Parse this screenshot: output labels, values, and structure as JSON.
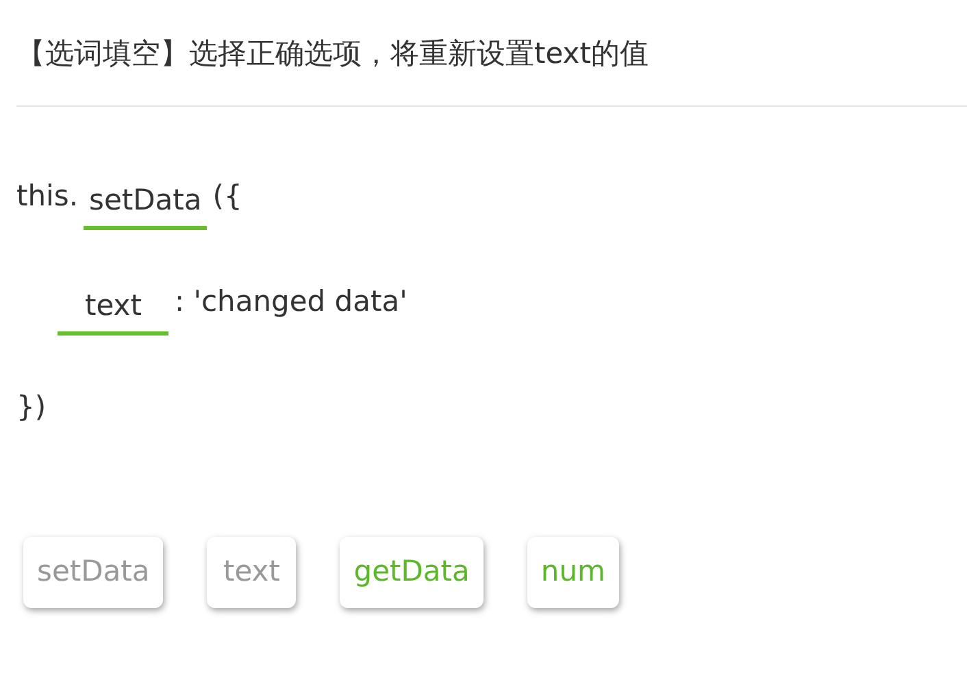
{
  "title": "【选词填空】选择正确选项，将重新设置text的值",
  "code_lines": [
    {
      "parts": [
        {
          "kind": "text",
          "text": "this."
        },
        {
          "kind": "blank",
          "text": "setData"
        },
        {
          "kind": "text",
          "text": "({"
        }
      ]
    },
    {
      "parts": [
        {
          "kind": "blank",
          "text": "text"
        },
        {
          "kind": "text",
          "text": ": 'changed data'"
        }
      ]
    },
    {
      "parts": [
        {
          "kind": "text",
          "text": "})"
        }
      ]
    }
  ],
  "options": [
    {
      "label": "setData",
      "used": true
    },
    {
      "label": "text",
      "used": true
    },
    {
      "label": "getData",
      "used": false
    },
    {
      "label": "num",
      "used": false
    }
  ]
}
